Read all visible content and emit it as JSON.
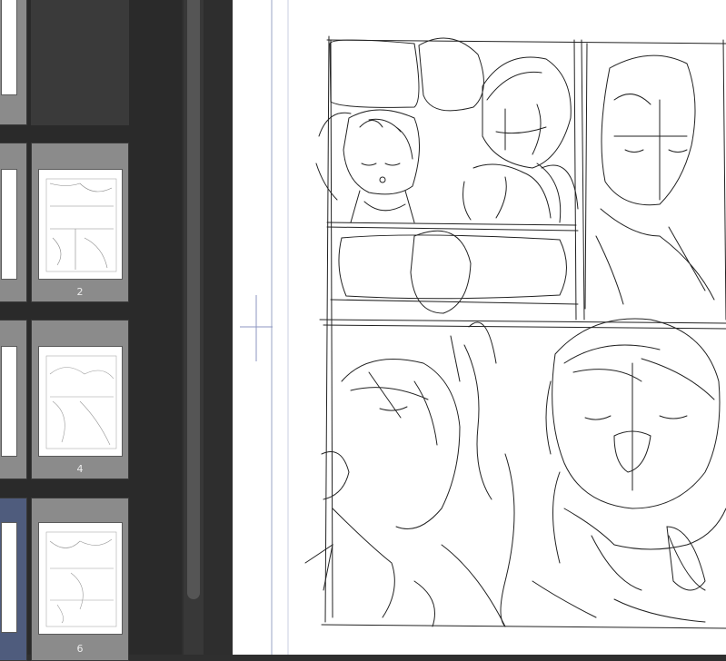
{
  "page_list": {
    "pages": [
      {
        "number": "2"
      },
      {
        "number": "4"
      },
      {
        "number": "6"
      }
    ]
  }
}
